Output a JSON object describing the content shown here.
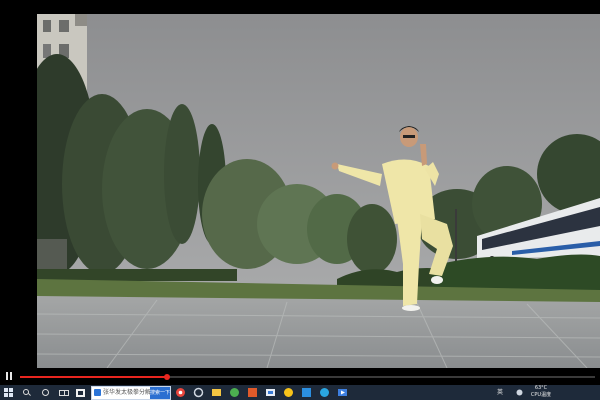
{
  "player": {
    "state": "playing",
    "progress_fraction": 0.255,
    "accent_color": "#e8261f"
  },
  "video": {
    "scene": "outdoor plaza, man in light yellow tai chi uniform performing a stance, trees and a tour bus behind, overcast sky"
  },
  "taskbar": {
    "search": {
      "query": "张华发太极拳分解教",
      "button_label": "搜索一下"
    },
    "pinned_icons": [
      "start-icon",
      "search-icon",
      "cortana-icon",
      "task-view-icon",
      "store-icon",
      "media-icon",
      "settings-icon",
      "browser-icon",
      "app-icon",
      "edge-icon",
      "folder-icon",
      "security-icon",
      "office-icon",
      "qq-icon",
      "app-icon",
      "app-icon",
      "video-player-icon"
    ],
    "tray": {
      "ime_label": "英",
      "cpu_temp": "63°C",
      "cpu_label": "CPU温度",
      "time": "",
      "date": ""
    }
  },
  "colors": {
    "taskbar_bg": "#1e2a3a",
    "tai_chi_uniform": "#efe6a8"
  }
}
